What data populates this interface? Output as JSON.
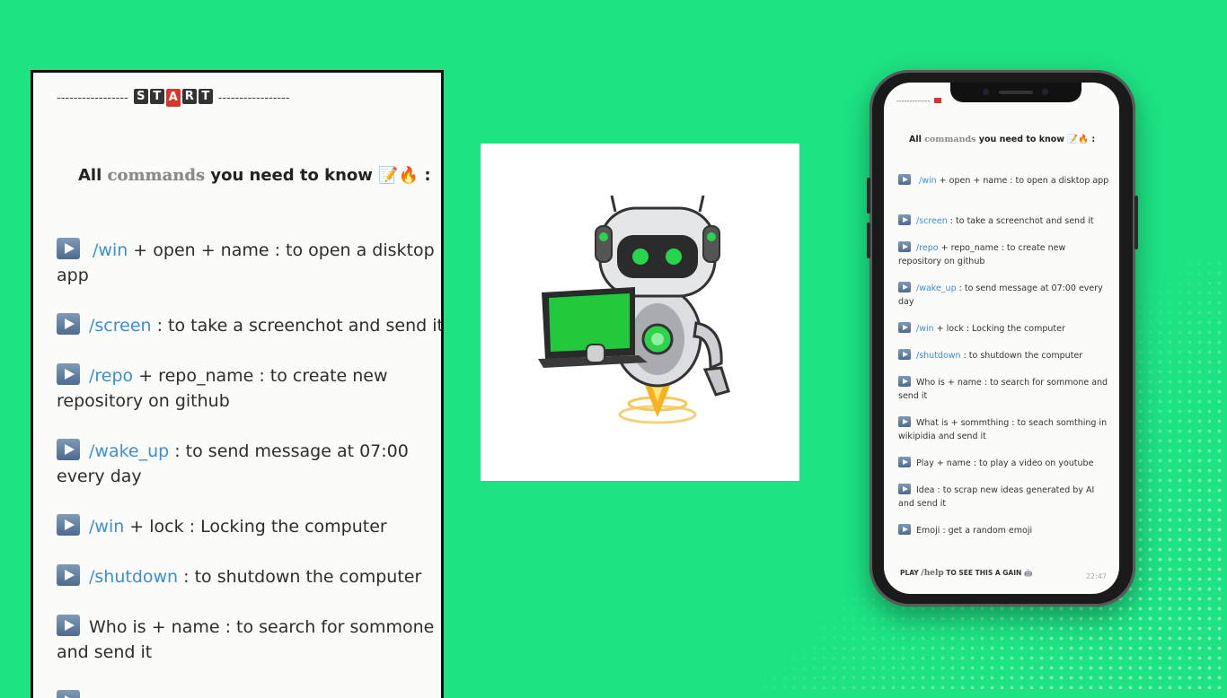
{
  "left_panel": {
    "start_dashes_left": "-----------------",
    "start_letters": [
      "S",
      "T",
      "A",
      "R",
      "T"
    ],
    "start_dashes_right": "-----------------",
    "headline_pre": "All ",
    "headline_kw": "commands",
    "headline_post": " you need to know",
    "headline_emoji": "📝🔥",
    "headline_colon": " :",
    "commands": [
      {
        "slash": "/win",
        "text": " + open + name : to open a disktop app"
      },
      {
        "slash": "/screen",
        "text": " : to take a screenchot and send it"
      },
      {
        "slash": "/repo",
        "text": " + repo_name : to create new repository on github"
      },
      {
        "slash": "/wake_up",
        "text": " : to send message at 07:00 every day"
      },
      {
        "slash": "/win",
        "text": " + lock : Locking the computer"
      },
      {
        "slash": "/shutdown",
        "text": " : to shutdown the computer"
      },
      {
        "slash": "",
        "text": "Who is + name  : to search for sommone and send it"
      }
    ]
  },
  "phone": {
    "start_dashes": "-------------",
    "headline_pre": "All ",
    "headline_kw": "commands",
    "headline_post": " you need to know",
    "headline_emoji": "📝🔥",
    "headline_colon": " :",
    "commands": [
      {
        "slash": "/win",
        "text": " + open + name : to open a disktop app"
      },
      {
        "slash": "/screen",
        "text": " : to take a screenchot and send it"
      },
      {
        "slash": "/repo",
        "text": " + repo_name : to create new repository on github"
      },
      {
        "slash": "/wake_up",
        "text": " : to send message at 07:00 every day"
      },
      {
        "slash": "/win",
        "text": " + lock : Locking the computer"
      },
      {
        "slash": "/shutdown",
        "text": " : to shutdown the computer"
      },
      {
        "slash": "",
        "text": "Who is + name  : to search for sommone and send it"
      },
      {
        "slash": "",
        "text": "What is + sommthing : to seach somthing in wikipidia and send it"
      },
      {
        "slash": "",
        "text": "Play + name : to play a video on youtube"
      },
      {
        "slash": "",
        "text": "Idea : to scrap new ideas generated by AI and send it"
      },
      {
        "slash": "",
        "text": "Emoji : get a random emoji"
      }
    ],
    "footer_pre": "PLAY ",
    "footer_kw": "/help",
    "footer_post": " TO SEE THIS A GAIN",
    "footer_emoji": "🤖",
    "time": "22:47"
  },
  "colors": {
    "background": "#1de383",
    "command_link": "#3b8fd4",
    "start_red": "#d8362b"
  }
}
